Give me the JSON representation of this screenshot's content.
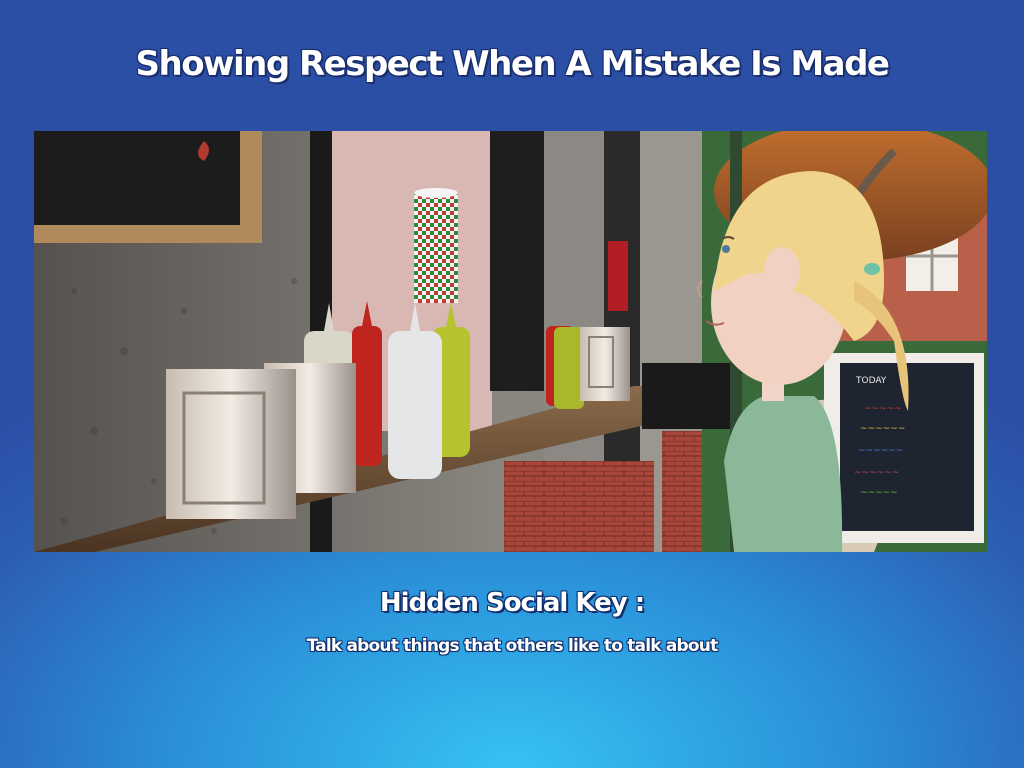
{
  "slide": {
    "title": "Showing Respect When A Mistake Is Made"
  },
  "scene_image": {
    "description_icon": "cafe-scene-image"
  },
  "social_key": {
    "heading": "Hidden Social Key :",
    "text": "Talk about things that others like to talk about"
  },
  "colors": {
    "background_top": "#2c4fa6",
    "background_bottom": "#36c2f2",
    "text": "#ffffff",
    "text_outline": "#1a2f6e"
  }
}
